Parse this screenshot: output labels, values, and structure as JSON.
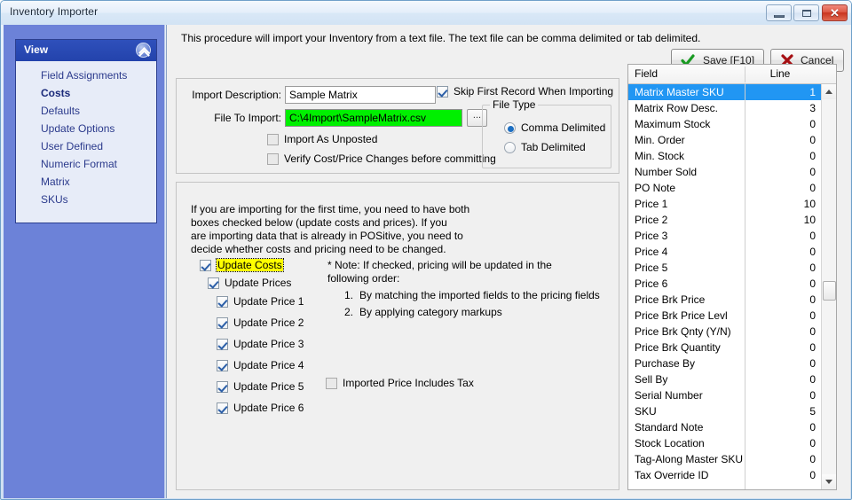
{
  "window": {
    "title": "Inventory Importer",
    "controls": {
      "minimize": "minimize-button",
      "maximize": "maximize-button",
      "close": "✕"
    }
  },
  "sidebar": {
    "group_title": "View",
    "items": [
      {
        "label": "Field Assignments",
        "selected": false
      },
      {
        "label": "Costs",
        "selected": true
      },
      {
        "label": "Defaults",
        "selected": false
      },
      {
        "label": "Update Options",
        "selected": false
      },
      {
        "label": "User Defined",
        "selected": false
      },
      {
        "label": "Numeric Format",
        "selected": false
      },
      {
        "label": "Matrix",
        "selected": false
      },
      {
        "label": "SKUs",
        "selected": false
      }
    ]
  },
  "main": {
    "intro": "This procedure will import your Inventory from a text file.  The text file can be comma delimited or tab delimited.",
    "save_label": "Save [F10]",
    "cancel_label": "Cancel",
    "import_description_label": "Import Description:",
    "import_description_value": "Sample Matrix",
    "file_to_import_label": "File To Import:",
    "file_to_import_value": "C:\\4Import\\SampleMatrix.csv",
    "browse_label": "...",
    "skip_first_record_label": "Skip First Record When Importing",
    "skip_first_record_checked": true,
    "import_as_unposted_label": "Import As Unposted",
    "import_as_unposted_checked": false,
    "verify_cost_label": "Verify Cost/Price Changes before committing",
    "verify_cost_checked": false,
    "file_type": {
      "legend": "File Type",
      "options": [
        {
          "label": "Comma Delimited",
          "selected": true
        },
        {
          "label": "Tab Delimited",
          "selected": false
        }
      ]
    },
    "instructions_line1": "If you are importing for the first time, you need to have both",
    "instructions_line2": "boxes checked below (update costs and  prices).  If you",
    "instructions_line3": "are importing data that is already in POSitive, you need to",
    "instructions_line4": "decide whether costs and pricing need to be changed.",
    "update_costs_label": "Update Costs",
    "update_costs_checked": true,
    "update_prices_label": "Update Prices",
    "update_prices_checked": true,
    "price_checkboxes": [
      {
        "label": "Update Price 1",
        "checked": true
      },
      {
        "label": "Update Price 2",
        "checked": true
      },
      {
        "label": "Update Price 3",
        "checked": true
      },
      {
        "label": "Update Price 4",
        "checked": true
      },
      {
        "label": "Update Price 5",
        "checked": true
      },
      {
        "label": "Update Price 6",
        "checked": true
      }
    ],
    "note_line1": "* Note: If checked, pricing will be updated in the",
    "note_line2": "following order:",
    "note_item1_num": "1.",
    "note_item1": "By matching the imported fields to the pricing fields",
    "note_item2_num": "2.",
    "note_item2": "By applying category markups",
    "imported_price_tax_label": "Imported Price Includes Tax",
    "imported_price_tax_checked": false
  },
  "grid": {
    "columns": [
      "Field",
      "Line"
    ],
    "rows": [
      {
        "field": "Matrix Master SKU",
        "line": "1",
        "selected": true
      },
      {
        "field": "Matrix Row Desc.",
        "line": "3",
        "selected": false
      },
      {
        "field": "Maximum Stock",
        "line": "0",
        "selected": false
      },
      {
        "field": "Min. Order",
        "line": "0",
        "selected": false
      },
      {
        "field": "Min. Stock",
        "line": "0",
        "selected": false
      },
      {
        "field": "Number Sold",
        "line": "0",
        "selected": false
      },
      {
        "field": "PO Note",
        "line": "0",
        "selected": false
      },
      {
        "field": "Price 1",
        "line": "10",
        "selected": false
      },
      {
        "field": "Price 2",
        "line": "10",
        "selected": false
      },
      {
        "field": "Price 3",
        "line": "0",
        "selected": false
      },
      {
        "field": "Price 4",
        "line": "0",
        "selected": false
      },
      {
        "field": "Price 5",
        "line": "0",
        "selected": false
      },
      {
        "field": "Price 6",
        "line": "0",
        "selected": false
      },
      {
        "field": "Price Brk Price",
        "line": "0",
        "selected": false
      },
      {
        "field": "Price Brk Price Levl",
        "line": "0",
        "selected": false
      },
      {
        "field": "Price Brk Qnty (Y/N)",
        "line": "0",
        "selected": false
      },
      {
        "field": "Price Brk Quantity",
        "line": "0",
        "selected": false
      },
      {
        "field": "Purchase By",
        "line": "0",
        "selected": false
      },
      {
        "field": "Sell By",
        "line": "0",
        "selected": false
      },
      {
        "field": "Serial Number",
        "line": "0",
        "selected": false
      },
      {
        "field": "SKU",
        "line": "5",
        "selected": false
      },
      {
        "field": "Standard Note",
        "line": "0",
        "selected": false
      },
      {
        "field": "Stock Location",
        "line": "0",
        "selected": false
      },
      {
        "field": "Tag-Along Master SKU",
        "line": "0",
        "selected": false
      },
      {
        "field": "Tax Override ID",
        "line": "0",
        "selected": false
      }
    ]
  },
  "colors": {
    "sidebar_bg": "#6c82d8",
    "selection": "#2196f3",
    "file_field_highlight": "#00f000",
    "focus_highlight": "#ffff00",
    "save_icon": "#1a9a23",
    "cancel_icon": "#a60f13"
  }
}
